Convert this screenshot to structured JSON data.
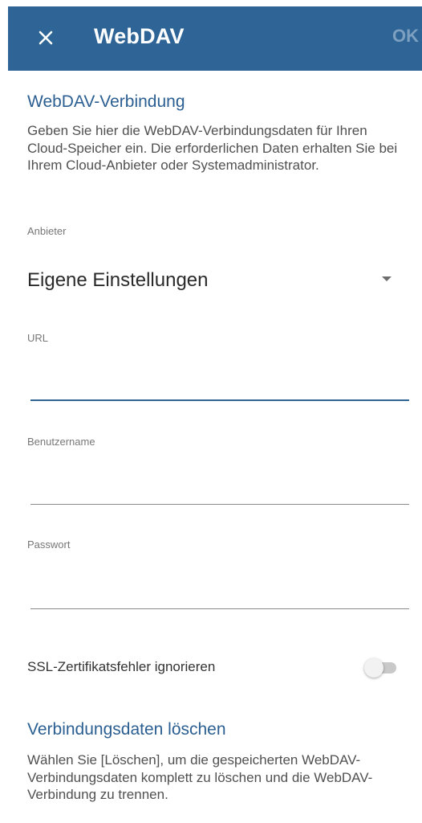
{
  "appbar": {
    "title": "WebDAV",
    "ok_label": "OK"
  },
  "connection": {
    "title": "WebDAV-Verbindung",
    "description": "Geben Sie hier die WebDAV-Verbindungsdaten für Ihren Cloud-Speicher ein. Die erforderlichen Daten erhalten Sie bei Ihrem Cloud-Anbieter oder Systemadministrator."
  },
  "provider": {
    "label": "Anbieter",
    "selected": "Eigene Einstellungen"
  },
  "url": {
    "label": "URL",
    "value": ""
  },
  "username": {
    "label": "Benutzername",
    "value": ""
  },
  "password": {
    "label": "Passwort",
    "value": ""
  },
  "ssl": {
    "label": "SSL-Zertifikatsfehler ignorieren",
    "enabled": false
  },
  "delete": {
    "title": "Verbindungsdaten löschen",
    "description": "Wählen Sie [Löschen], um die gespeicherten WebDAV-Verbindungsdaten komplett zu löschen und die WebDAV-Verbindung zu trennen."
  },
  "colors": {
    "appbar": "#2e6596",
    "accent": "#2b5f91",
    "focused_underline": "#2e6596"
  }
}
